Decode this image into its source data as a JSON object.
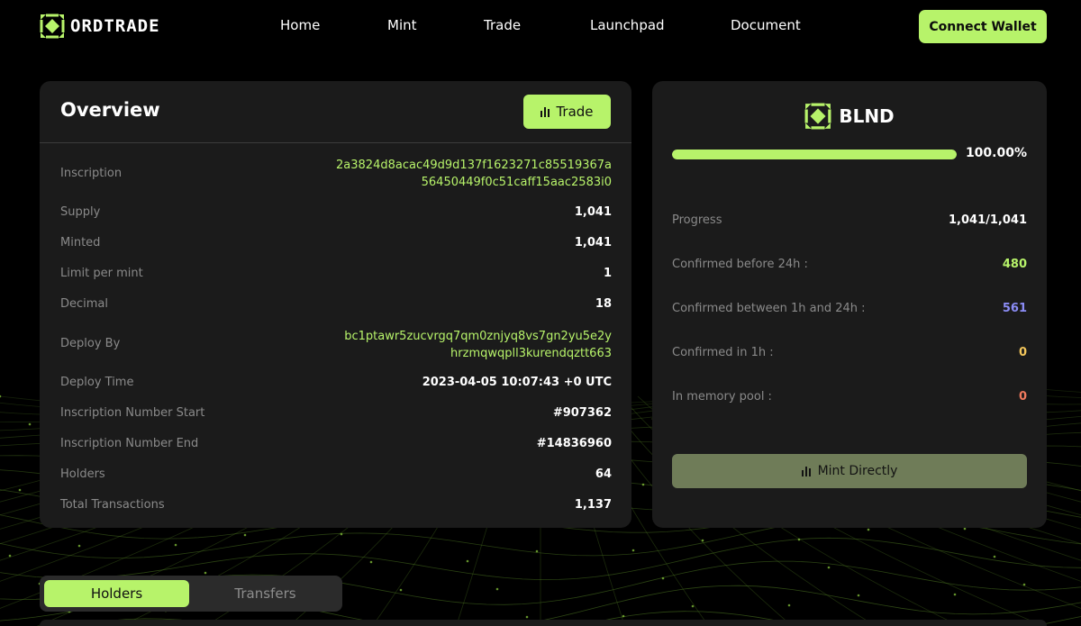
{
  "brand": {
    "name": "ORDTRADE",
    "accent": "#b7f36a"
  },
  "nav": [
    "Home",
    "Mint",
    "Trade",
    "Launchpad",
    "Document"
  ],
  "header": {
    "connect_label": "Connect Wallet"
  },
  "overview": {
    "title": "Overview",
    "trade_label": "Trade",
    "rows": [
      {
        "label": "Inscription",
        "value_line1": "2a3824d8acac49d9d137f1623271c85519367a",
        "value_line2": "56450449f0c51caff15aac2583i0"
      },
      {
        "label": "Supply",
        "value": "1,041"
      },
      {
        "label": "Minted",
        "value": "1,041"
      },
      {
        "label": "Limit per mint",
        "value": "1"
      },
      {
        "label": "Decimal",
        "value": "18"
      },
      {
        "label": "Deploy By",
        "value_line1": "bc1ptawr5zucvrgq7qm0znjyq8vs7gn2yu5e2y",
        "value_line2": "hrzmqwqpll3kurendqztt663"
      },
      {
        "label": "Deploy Time",
        "value": "2023-04-05 10:07:43 +0 UTC"
      },
      {
        "label": "Inscription Number Start",
        "value": "#907362"
      },
      {
        "label": "Inscription Number End",
        "value": "#14836960"
      },
      {
        "label": "Holders",
        "value": "64"
      },
      {
        "label": "Total Transactions",
        "value": "1,137"
      }
    ]
  },
  "token": {
    "name": "BLND",
    "progress_fraction": 1.0,
    "progress_pct": "100.00%",
    "stats": [
      {
        "label": "Progress",
        "value": "1,041/1,041",
        "color": "#ffffff"
      },
      {
        "label": "Confirmed before 24h :",
        "value": "480",
        "color": "#b7f36a"
      },
      {
        "label": "Confirmed between 1h and 24h :",
        "value": "561",
        "color": "#8b8cf5"
      },
      {
        "label": "Confirmed in 1h :",
        "value": "0",
        "color": "#f3c65b"
      },
      {
        "label": "In memory pool :",
        "value": "0",
        "color": "#f07a5e"
      }
    ],
    "mint_label": "Mint Directly"
  },
  "tabs": {
    "holders": "Holders",
    "transfers": "Transfers"
  }
}
